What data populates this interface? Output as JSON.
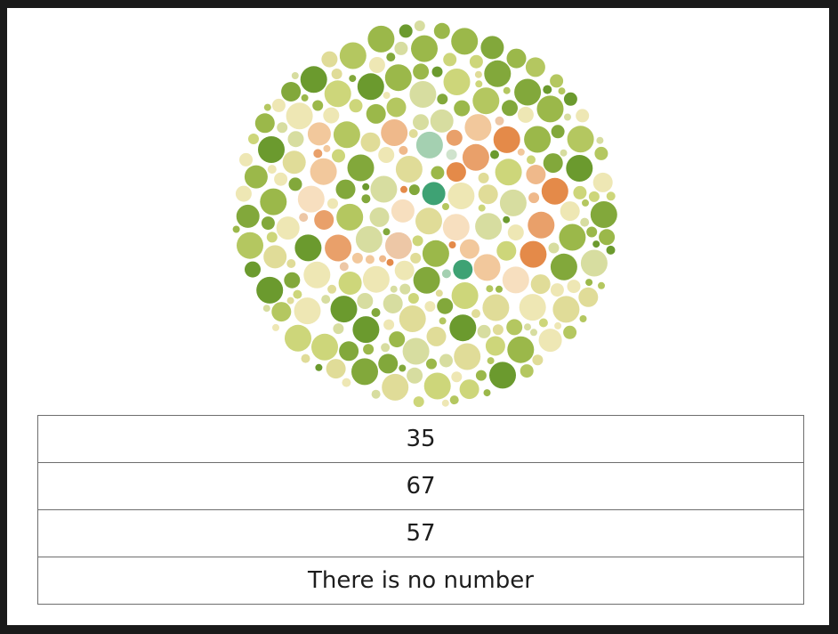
{
  "plate": {
    "icon": "ishihara-color-plate",
    "palette": {
      "background_dots": [
        "#6b9a2e",
        "#82a83b",
        "#9bb84a",
        "#b4c760",
        "#cdd67a",
        "#e0dc98",
        "#eee7b4",
        "#d7dda0"
      ],
      "figure_dots": [
        "#f2c89c",
        "#efb98b",
        "#e9a06a",
        "#e48a49",
        "#f7dfbf",
        "#edc7a6"
      ],
      "teal_dots": [
        "#2f8f63",
        "#3ea274",
        "#68b68d",
        "#a4d0b1",
        "#cfe3cd"
      ]
    }
  },
  "options": [
    {
      "label": "35"
    },
    {
      "label": "67"
    },
    {
      "label": "57"
    },
    {
      "label": "There is no number"
    }
  ]
}
